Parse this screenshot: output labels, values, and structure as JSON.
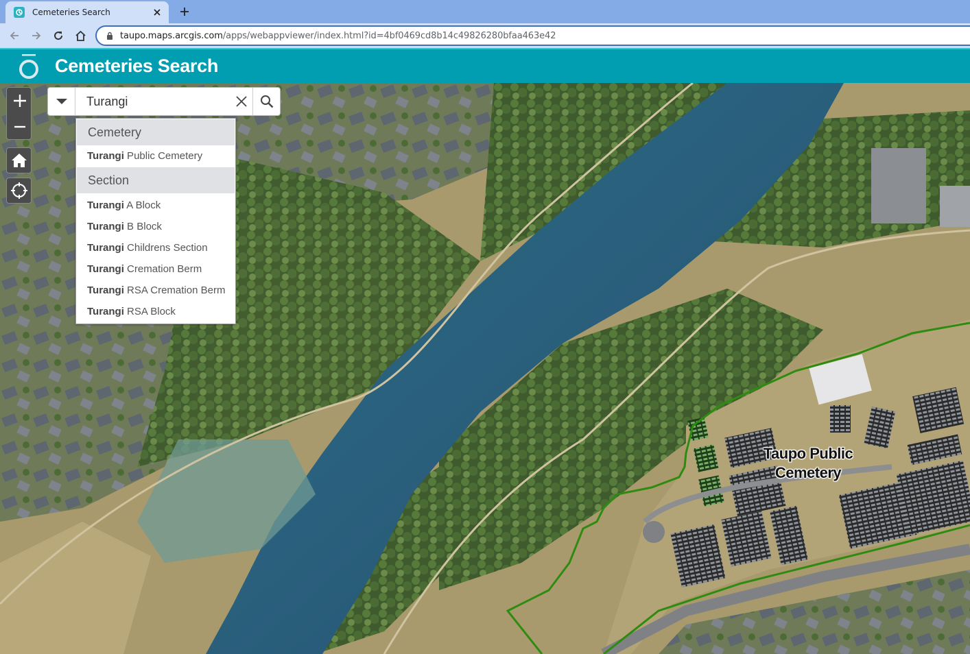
{
  "browser": {
    "tab_title": "Cemeteries Search",
    "url_host": "taupo.maps.arcgis.com",
    "url_rest": "/apps/webappviewer/index.html?id=4bf0469cd8b14c49826280bfaa463e42"
  },
  "app": {
    "title": "Cemeteries Search"
  },
  "search": {
    "value": "Turangi",
    "placeholder": "",
    "groups": [
      {
        "header": "Cemetery",
        "items": [
          {
            "match": "Turangi",
            "rest": " Public Cemetery"
          }
        ]
      },
      {
        "header": "Section",
        "items": [
          {
            "match": "Turangi",
            "rest": " A Block"
          },
          {
            "match": "Turangi",
            "rest": " B Block"
          },
          {
            "match": "Turangi",
            "rest": " Childrens Section"
          },
          {
            "match": "Turangi",
            "rest": " Cremation Berm"
          },
          {
            "match": "Turangi",
            "rest": " RSA Cremation Berm"
          },
          {
            "match": "Turangi",
            "rest": " RSA Block"
          }
        ]
      }
    ]
  },
  "map": {
    "feature_label": "Taupo Public Cemetery",
    "boundary_color": "#2e8b10"
  },
  "icons": {
    "favicon": "arcgis-favicon",
    "zoom_in": "plus-icon",
    "zoom_out": "minus-icon",
    "home": "home-icon",
    "locate": "locate-crosshair-icon",
    "search_source": "caret-down-icon",
    "clear": "close-icon",
    "search": "search-icon"
  }
}
